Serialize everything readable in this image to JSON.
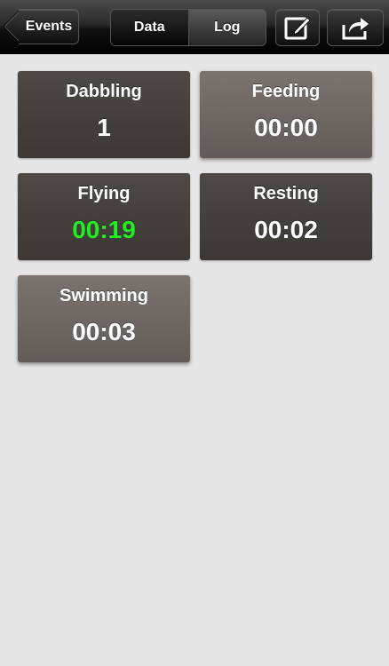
{
  "navbar": {
    "back_label": "Events",
    "segments": [
      {
        "label": "Data",
        "selected": false
      },
      {
        "label": "Log",
        "selected": true
      }
    ],
    "edit_icon": "edit-icon",
    "share_icon": "share-icon"
  },
  "tiles": [
    {
      "name": "Dabbling",
      "value": "1",
      "highlighted": false,
      "running": false
    },
    {
      "name": "Feeding",
      "value": "00:00",
      "highlighted": true,
      "running": false
    },
    {
      "name": "Flying",
      "value": "00:19",
      "highlighted": false,
      "running": true
    },
    {
      "name": "Resting",
      "value": "00:02",
      "highlighted": false,
      "running": false
    },
    {
      "name": "Swimming",
      "value": "00:03",
      "highlighted": true,
      "running": false
    }
  ],
  "colors": {
    "background": "#e6e6e6",
    "tile": "#45413e",
    "tile_highlighted": "#6e6762",
    "running_value": "#22ee22"
  }
}
